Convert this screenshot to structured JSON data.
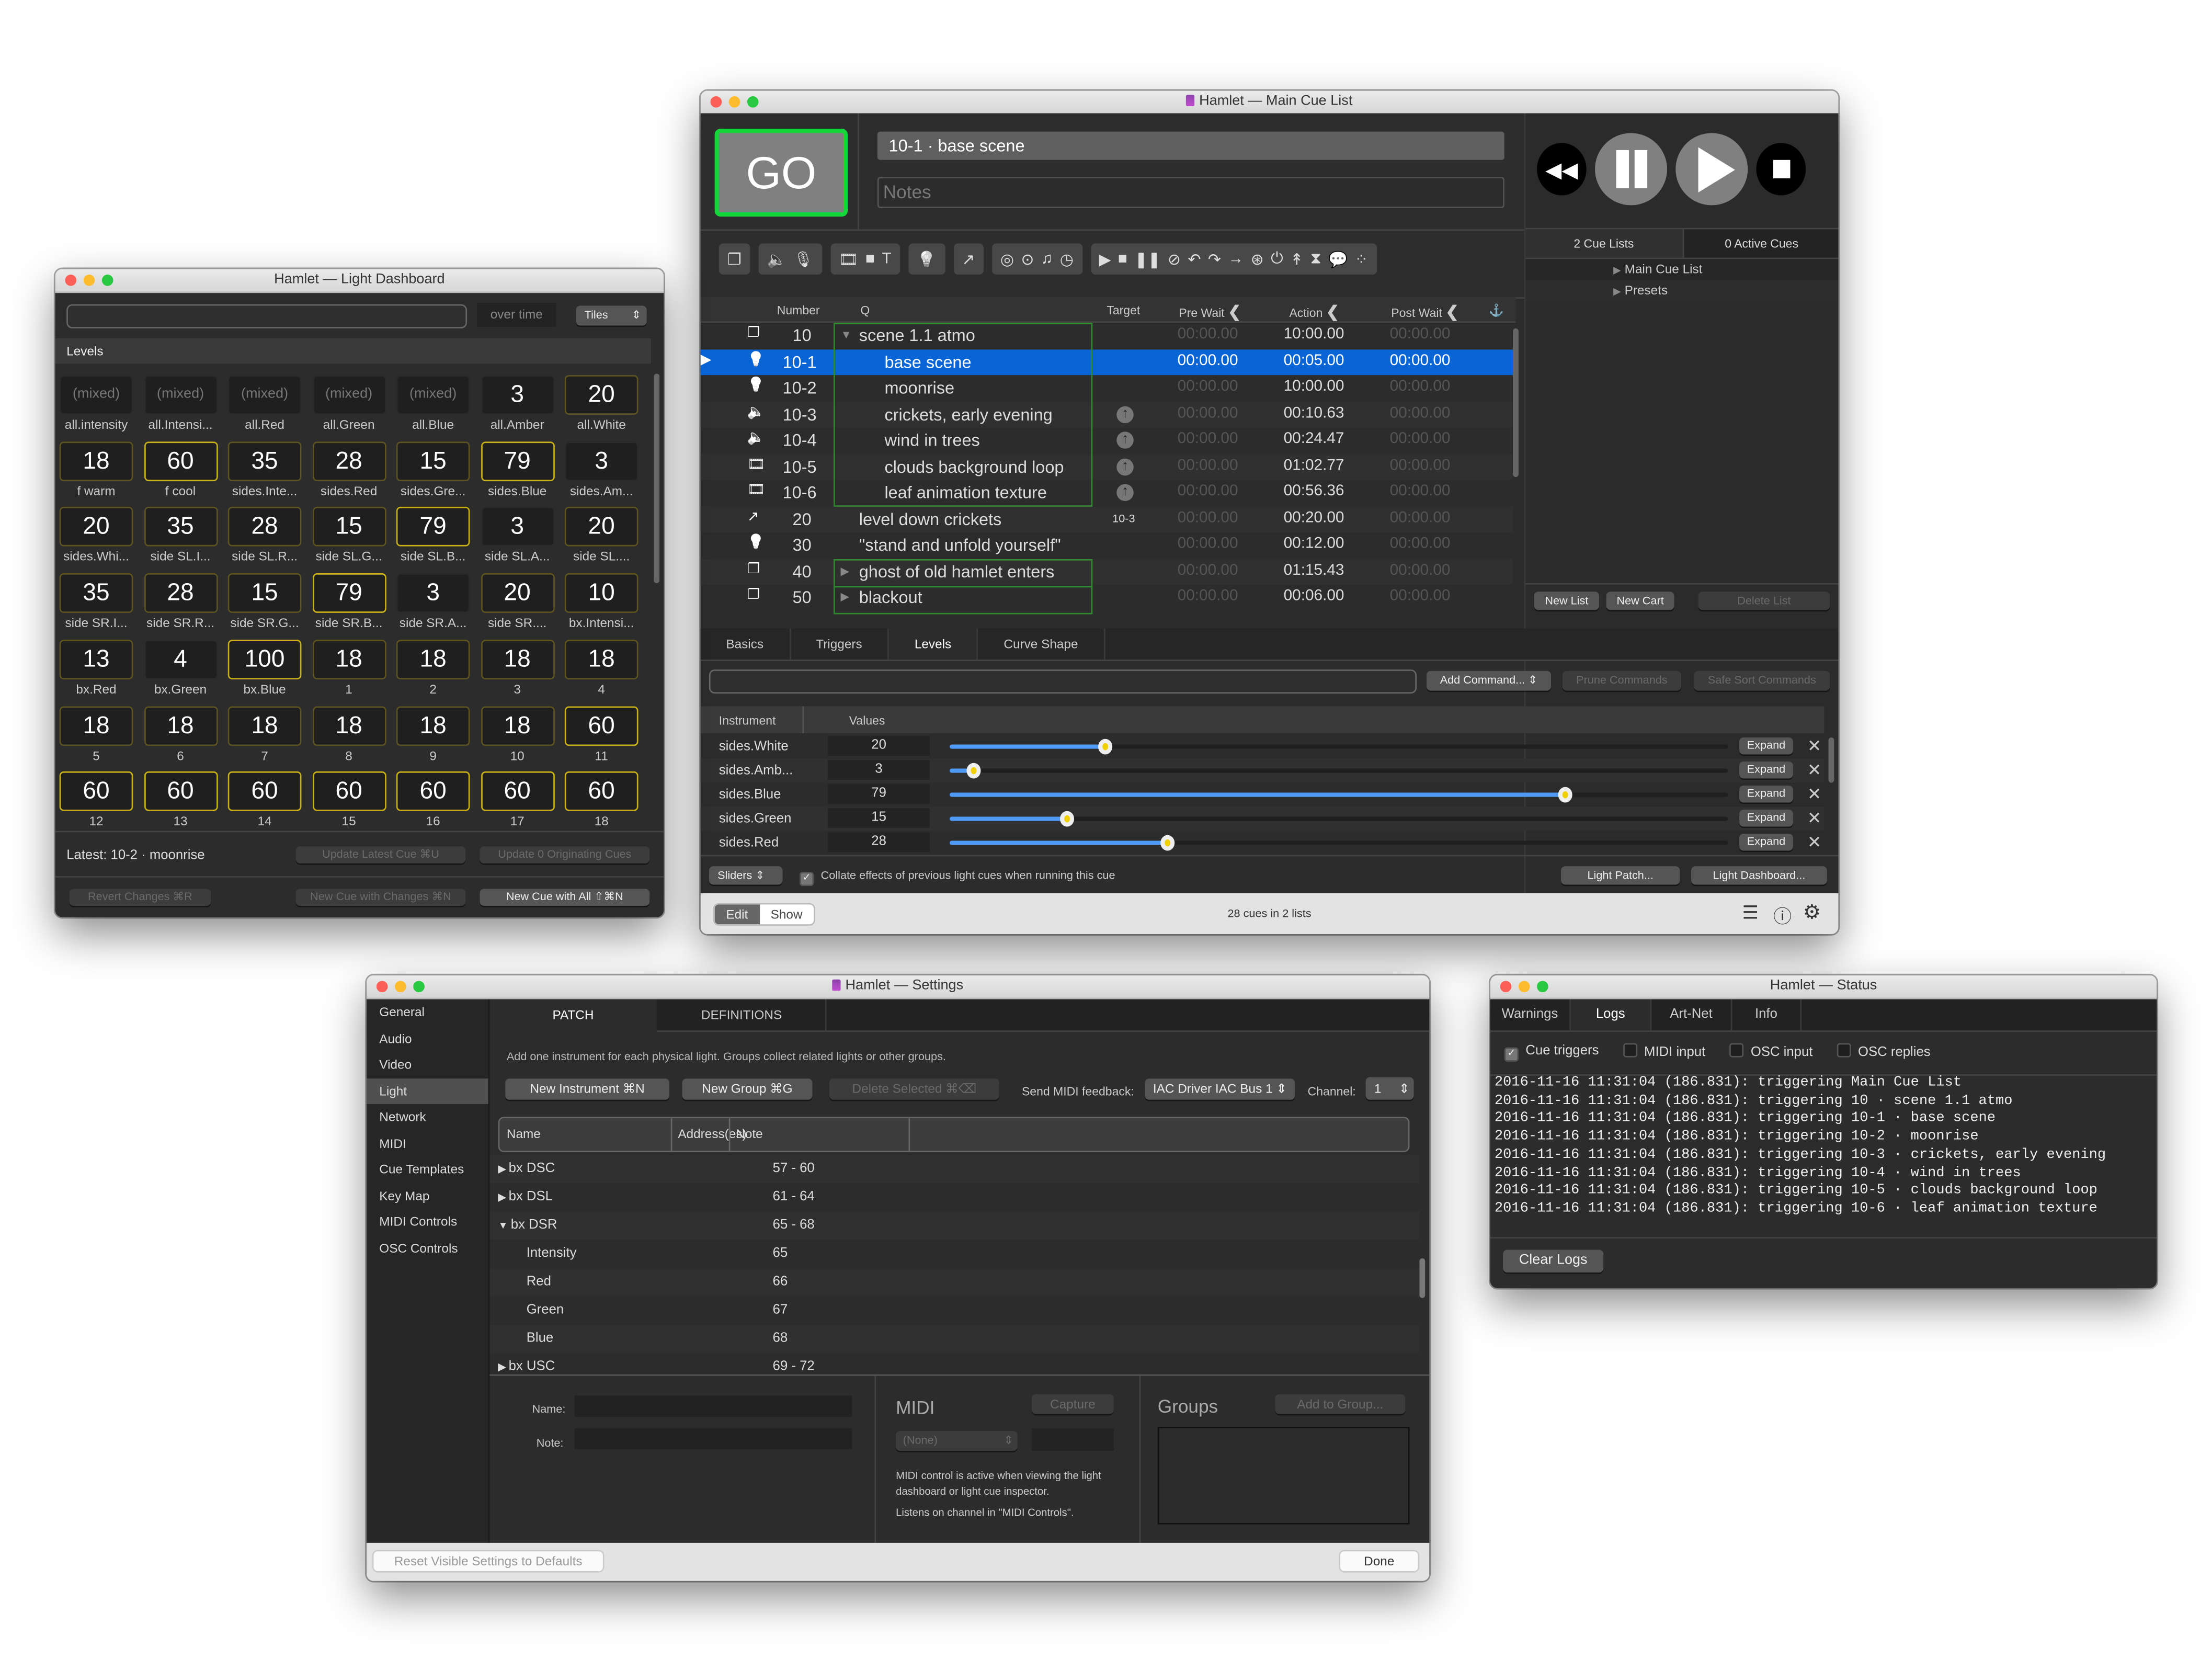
{
  "main_window": {
    "title": "Hamlet — Main Cue List",
    "go_label": "GO",
    "current_cue": "10-1 · base scene",
    "notes_placeholder": "Notes",
    "toolbar_groups": [
      [
        "group-icon"
      ],
      [
        "audio-icon",
        "mic-icon"
      ],
      [
        "video-icon",
        "camera-icon",
        "text-icon"
      ],
      [
        "light-icon"
      ],
      [
        "fade-icon"
      ],
      [
        "network-icon",
        "midi-icon",
        "music-icon",
        "timecode-icon"
      ],
      [
        "start-icon",
        "stop-icon",
        "pause-icon",
        "load-icon",
        "reset-icon",
        "devamp-icon",
        "goto-icon",
        "target-icon",
        "arm-icon",
        "disarm-icon",
        "wait-icon",
        "memo-icon",
        "script-icon"
      ]
    ],
    "transport": {
      "rewind": "rewind-icon",
      "pause": "pause-icon",
      "play": "play-icon",
      "stop": "stop-icon"
    },
    "right_panel": {
      "tab_lists": "2 Cue Lists",
      "tab_active": "0 Active Cues",
      "lists": [
        "Main Cue List",
        "Presets"
      ],
      "new_list": "New List",
      "new_cart": "New Cart",
      "delete_list": "Delete List"
    },
    "columns": {
      "number": "Number",
      "q": "Q",
      "target": "Target",
      "pre_wait": "Pre Wait",
      "action": "Action",
      "post_wait": "Post Wait"
    },
    "cues": [
      {
        "icon": "group",
        "number": "10",
        "name": "scene 1.1 atmo",
        "target": "",
        "pre": "00:00.00",
        "action": "10:00.00",
        "post": "00:00.00",
        "indent": 0,
        "disclosure": "open"
      },
      {
        "icon": "light",
        "number": "10-1",
        "name": "base scene",
        "target": "",
        "pre": "00:00.00",
        "action": "00:05.00",
        "post": "00:00.00",
        "indent": 1,
        "selected": true
      },
      {
        "icon": "light",
        "number": "10-2",
        "name": "moonrise",
        "target": "",
        "pre": "00:00.00",
        "action": "10:00.00",
        "post": "00:00.00",
        "indent": 1
      },
      {
        "icon": "audio",
        "number": "10-3",
        "name": "crickets, early evening",
        "target": "arrow",
        "pre": "00:00.00",
        "action": "00:10.63",
        "post": "00:00.00",
        "indent": 1
      },
      {
        "icon": "audio",
        "number": "10-4",
        "name": "wind in trees",
        "target": "arrow",
        "pre": "00:00.00",
        "action": "00:24.47",
        "post": "00:00.00",
        "indent": 1
      },
      {
        "icon": "video",
        "number": "10-5",
        "name": "clouds background loop",
        "target": "arrow",
        "pre": "00:00.00",
        "action": "01:02.77",
        "post": "00:00.00",
        "indent": 1
      },
      {
        "icon": "video",
        "number": "10-6",
        "name": "leaf animation texture",
        "target": "arrow",
        "pre": "00:00.00",
        "action": "00:56.36",
        "post": "00:00.00",
        "indent": 1
      },
      {
        "icon": "fade",
        "number": "20",
        "name": "level down crickets",
        "target": "10-3",
        "pre": "00:00.00",
        "action": "00:20.00",
        "post": "00:00.00",
        "indent": 0
      },
      {
        "icon": "light",
        "number": "30",
        "name": "\"stand and unfold yourself\"",
        "target": "",
        "pre": "00:00.00",
        "action": "00:12.00",
        "post": "00:00.00",
        "indent": 0
      },
      {
        "icon": "group",
        "number": "40",
        "name": "ghost of old hamlet enters",
        "target": "",
        "pre": "00:00.00",
        "action": "01:15.43",
        "post": "00:00.00",
        "indent": 0,
        "disclosure": "closed"
      },
      {
        "icon": "group",
        "number": "50",
        "name": "blackout",
        "target": "",
        "pre": "00:00.00",
        "action": "00:06.00",
        "post": "00:00.00",
        "indent": 0,
        "disclosure": "closed"
      }
    ],
    "inspector_tabs": [
      "Basics",
      "Triggers",
      "Levels",
      "Curve Shape"
    ],
    "active_tab": "Levels",
    "add_command": "Add Command...",
    "prune_commands": "Prune Commands",
    "safe_sort": "Safe Sort Commands",
    "levels_header": {
      "instrument": "Instrument",
      "values": "Values"
    },
    "levels": [
      {
        "name": "sides.White",
        "value": 20
      },
      {
        "name": "sides.Amb...",
        "value": 3
      },
      {
        "name": "sides.Blue",
        "value": 79
      },
      {
        "name": "sides.Green",
        "value": 15
      },
      {
        "name": "sides.Red",
        "value": 28
      }
    ],
    "expand_label": "Expand",
    "sliders_select": "Sliders",
    "collate_label": "Collate effects of previous light cues when running this cue",
    "collate_checked": true,
    "light_patch": "Light Patch...",
    "light_dashboard": "Light Dashboard...",
    "mode_edit": "Edit",
    "mode_show": "Show",
    "cue_count": "28 cues in 2 lists"
  },
  "dashboard": {
    "title": "Hamlet — Light Dashboard",
    "over_time": "over time",
    "view_select": "Tiles",
    "section": "Levels",
    "tiles": [
      {
        "v": "(mixed)",
        "l": "all.intensity",
        "s": 0
      },
      {
        "v": "(mixed)",
        "l": "all.Intensi...",
        "s": 0
      },
      {
        "v": "(mixed)",
        "l": "all.Red",
        "s": 0
      },
      {
        "v": "(mixed)",
        "l": "all.Green",
        "s": 0
      },
      {
        "v": "(mixed)",
        "l": "all.Blue",
        "s": 0
      },
      {
        "v": "3",
        "l": "all.Amber",
        "s": 0
      },
      {
        "v": "20",
        "l": "all.White",
        "s": 1
      },
      {
        "v": "18",
        "l": "f warm",
        "s": 1
      },
      {
        "v": "60",
        "l": "f cool",
        "s": 2
      },
      {
        "v": "35",
        "l": "sides.Inte...",
        "s": 1
      },
      {
        "v": "28",
        "l": "sides.Red",
        "s": 1
      },
      {
        "v": "15",
        "l": "sides.Gre...",
        "s": 1
      },
      {
        "v": "79",
        "l": "sides.Blue",
        "s": 2
      },
      {
        "v": "3",
        "l": "sides.Am...",
        "s": 0
      },
      {
        "v": "20",
        "l": "sides.Whi...",
        "s": 1
      },
      {
        "v": "35",
        "l": "side SL.I...",
        "s": 1
      },
      {
        "v": "28",
        "l": "side SL.R...",
        "s": 1
      },
      {
        "v": "15",
        "l": "side SL.G...",
        "s": 1
      },
      {
        "v": "79",
        "l": "side SL.B...",
        "s": 2
      },
      {
        "v": "3",
        "l": "side SL.A...",
        "s": 0
      },
      {
        "v": "20",
        "l": "side SL....",
        "s": 1
      },
      {
        "v": "35",
        "l": "side SR.I...",
        "s": 1
      },
      {
        "v": "28",
        "l": "side SR.R...",
        "s": 1
      },
      {
        "v": "15",
        "l": "side SR.G...",
        "s": 1
      },
      {
        "v": "79",
        "l": "side SR.B...",
        "s": 2
      },
      {
        "v": "3",
        "l": "side SR.A...",
        "s": 0
      },
      {
        "v": "20",
        "l": "side SR....",
        "s": 1
      },
      {
        "v": "10",
        "l": "bx.Intensi...",
        "s": 1
      },
      {
        "v": "13",
        "l": "bx.Red",
        "s": 1
      },
      {
        "v": "4",
        "l": "bx.Green",
        "s": 0
      },
      {
        "v": "100",
        "l": "bx.Blue",
        "s": 2
      },
      {
        "v": "18",
        "l": "1",
        "s": 1
      },
      {
        "v": "18",
        "l": "2",
        "s": 1
      },
      {
        "v": "18",
        "l": "3",
        "s": 1
      },
      {
        "v": "18",
        "l": "4",
        "s": 1
      },
      {
        "v": "18",
        "l": "5",
        "s": 1
      },
      {
        "v": "18",
        "l": "6",
        "s": 1
      },
      {
        "v": "18",
        "l": "7",
        "s": 1
      },
      {
        "v": "18",
        "l": "8",
        "s": 1
      },
      {
        "v": "18",
        "l": "9",
        "s": 1
      },
      {
        "v": "18",
        "l": "10",
        "s": 1
      },
      {
        "v": "60",
        "l": "11",
        "s": 2
      },
      {
        "v": "60",
        "l": "12",
        "s": 2
      },
      {
        "v": "60",
        "l": "13",
        "s": 2
      },
      {
        "v": "60",
        "l": "14",
        "s": 2
      },
      {
        "v": "60",
        "l": "15",
        "s": 2
      },
      {
        "v": "60",
        "l": "16",
        "s": 2
      },
      {
        "v": "60",
        "l": "17",
        "s": 2
      },
      {
        "v": "60",
        "l": "18",
        "s": 2
      }
    ],
    "latest": "Latest: 10-2 · moonrise",
    "update_latest": "Update Latest Cue  ⌘U",
    "update_originating": "Update 0 Originating Cues",
    "revert": "Revert Changes  ⌘R",
    "new_with_changes": "New Cue with Changes  ⌘N",
    "new_with_all": "New Cue with All  ⇧⌘N"
  },
  "settings": {
    "title": "Hamlet — Settings",
    "nav": [
      "General",
      "Audio",
      "Video",
      "Light",
      "Network",
      "MIDI",
      "Cue Templates",
      "Key Map",
      "MIDI Controls",
      "OSC Controls"
    ],
    "nav_active": "Light",
    "tabs": [
      "PATCH",
      "DEFINITIONS"
    ],
    "hint": "Add one instrument for each physical light.  Groups collect related lights or other groups.",
    "new_instrument": "New Instrument  ⌘N",
    "new_group": "New Group  ⌘G",
    "delete_selected": "Delete Selected  ⌘⌫",
    "midi_feedback_label": "Send MIDI feedback:",
    "midi_feedback_value": "IAC Driver IAC Bus 1",
    "channel_label": "Channel:",
    "channel_value": "1",
    "columns": {
      "name": "Name",
      "address": "Address(es)",
      "note": "Note"
    },
    "patch": [
      {
        "name": "bx DSC",
        "addr": "57 - 60",
        "disc": "closed",
        "indent": 0
      },
      {
        "name": "bx DSL",
        "addr": "61 - 64",
        "disc": "closed",
        "indent": 0
      },
      {
        "name": "bx DSR",
        "addr": "65 - 68",
        "disc": "open",
        "indent": 0
      },
      {
        "name": "Intensity",
        "addr": "65",
        "disc": "",
        "indent": 1
      },
      {
        "name": "Red",
        "addr": "66",
        "disc": "",
        "indent": 1
      },
      {
        "name": "Green",
        "addr": "67",
        "disc": "",
        "indent": 1
      },
      {
        "name": "Blue",
        "addr": "68",
        "disc": "",
        "indent": 1
      },
      {
        "name": "bx USC",
        "addr": "69 - 72",
        "disc": "closed",
        "indent": 0
      }
    ],
    "name_label": "Name:",
    "note_label": "Note:",
    "midi_heading": "MIDI",
    "capture": "Capture",
    "midi_select": "(None)",
    "midi_help1": "MIDI control is active when viewing the light dashboard or light cue inspector.",
    "midi_help2": "Listens on channel in \"MIDI Controls\".",
    "groups_heading": "Groups",
    "add_to_group": "Add to Group...",
    "reset": "Reset Visible Settings to Defaults",
    "done": "Done"
  },
  "status": {
    "title": "Hamlet — Status",
    "tabs": [
      "Warnings",
      "Logs",
      "Art-Net",
      "Info"
    ],
    "active_tab": "Logs",
    "filters": [
      {
        "label": "Cue triggers",
        "checked": true
      },
      {
        "label": "MIDI input",
        "checked": false
      },
      {
        "label": "OSC input",
        "checked": false
      },
      {
        "label": "OSC replies",
        "checked": false
      }
    ],
    "logs": [
      "2016-11-16 11:31:04 (186.831): triggering Main Cue List",
      "2016-11-16 11:31:04 (186.831): triggering 10 · scene 1.1 atmo",
      "2016-11-16 11:31:04 (186.831): triggering 10-1 · base scene",
      "2016-11-16 11:31:04 (186.831): triggering 10-2 · moonrise",
      "2016-11-16 11:31:04 (186.831): triggering 10-3 · crickets, early evening",
      "2016-11-16 11:31:04 (186.831): triggering 10-4 · wind in trees",
      "2016-11-16 11:31:04 (186.831): triggering 10-5 · clouds background loop",
      "2016-11-16 11:31:04 (186.831): triggering 10-6 · leaf animation texture"
    ],
    "clear_logs": "Clear Logs"
  },
  "colors": {
    "selection": "#0965d6",
    "go_border": "#14d63a",
    "tile_active": "#c9b117",
    "slider_fill": "#4f9af5",
    "group_border": "#2f8a2f"
  }
}
